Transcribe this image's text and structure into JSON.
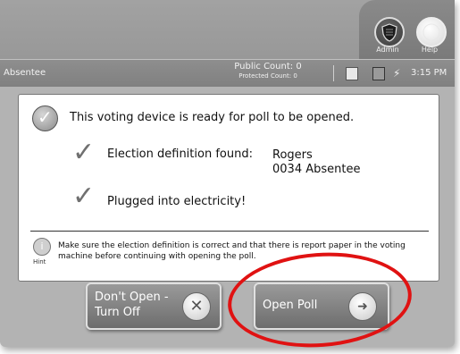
{
  "header": {
    "admin_label": "Admin",
    "help_label": "Help",
    "admin_icon": "shield-icon",
    "help_icon": "help-icon"
  },
  "status_bar": {
    "mode": "Absentee",
    "public_count": "Public Count: 0",
    "protected_count": "Protected Count: 0",
    "time": "3:15 PM",
    "icons": [
      "document-icon",
      "disk-icon",
      "plug-icon"
    ]
  },
  "main": {
    "ready_message": "This voting device is ready for poll to be opened.",
    "election_definition_label": "Election definition found:",
    "election_definition_lines": [
      "Rogers",
      "0034 Absentee"
    ],
    "power_message": "Plugged into electricity!",
    "hint_label": "Hint",
    "hint_text": "Make sure the election definition is correct and that there is report paper in the voting machine before continuing with opening the poll."
  },
  "buttons": {
    "dont_open_lines": [
      "Don't Open -",
      "Turn Off"
    ],
    "open_poll": "Open Poll"
  },
  "colors": {
    "annotation": "#e01212",
    "toolbar": "#989898",
    "background": "#b3b3b3"
  }
}
